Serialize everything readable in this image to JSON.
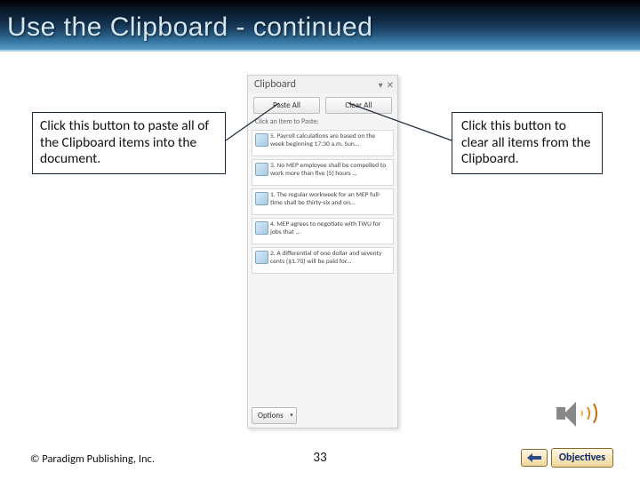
{
  "title": "Use the Clipboard - continued",
  "callouts": {
    "left": "Click this button to paste all of the Clipboard items into the document.",
    "right": "Click this button to clear all items from the Clipboard."
  },
  "clipboard": {
    "header": "Clipboard",
    "paste_all": "Paste All",
    "clear_all": "Clear All",
    "hint": "Click an Item to Paste:",
    "items": [
      "5. Payroll calculations are based on the week beginning 17:30 a.m. Sun...",
      "3. No MEP employee shall be compelled to work more than five (5) hours ...",
      "1. The regular workweek for an MEP full-time shall be thirty-six and on...",
      "4. MEP agrees to negotiate with TWU for jobs that ...",
      "2. A differential of one dollar and seventy cents ($1.70) will be paid for..."
    ],
    "options": "Options"
  },
  "footer": {
    "copyright": "© Paradigm Publishing, Inc.",
    "page": "33",
    "objectives": "Objectives"
  }
}
